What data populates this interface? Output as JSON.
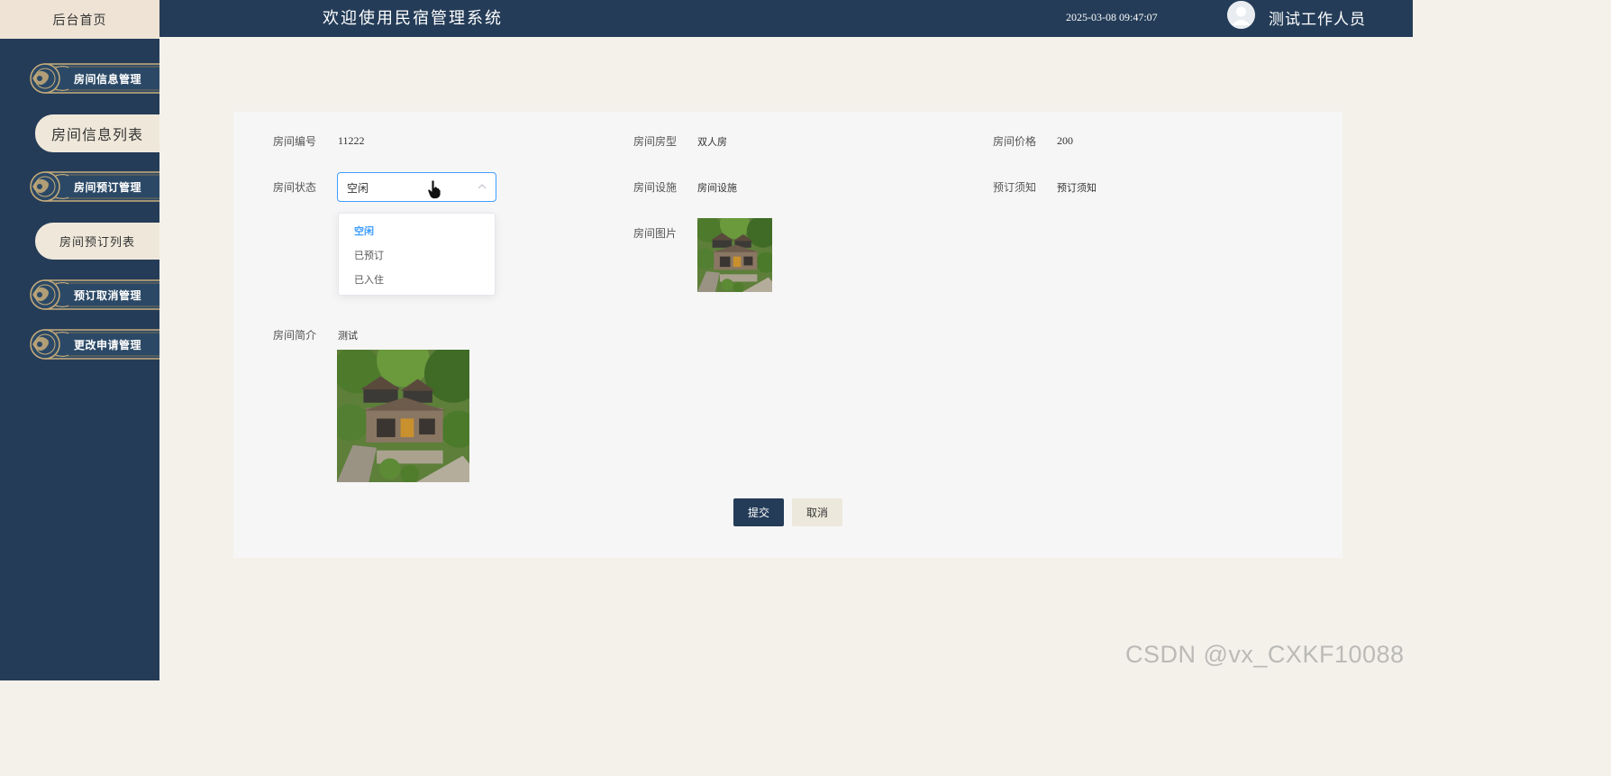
{
  "header": {
    "home_tab": "后台首页",
    "app_title": "欢迎使用民宿管理系统",
    "clock": "2025-03-08 09:47:07",
    "user_name": "测试工作人员"
  },
  "sidebar": {
    "items": [
      {
        "label": "房间信息管理",
        "type": "group"
      },
      {
        "label": "房间信息列表",
        "type": "submenu"
      },
      {
        "label": "房间预订管理",
        "type": "group"
      },
      {
        "label": "房间预订列表",
        "type": "submenu"
      },
      {
        "label": "预订取消管理",
        "type": "group"
      },
      {
        "label": "更改申请管理",
        "type": "group"
      }
    ]
  },
  "form": {
    "room_number": {
      "label": "房间编号",
      "value": "11222"
    },
    "room_type": {
      "label": "房间房型",
      "value": "双人房"
    },
    "room_price": {
      "label": "房间价格",
      "value": "200"
    },
    "room_status": {
      "label": "房间状态",
      "value": "空闲",
      "options": [
        "空闲",
        "已预订",
        "已入住"
      ]
    },
    "room_facilities": {
      "label": "房间设施",
      "value": "房间设施"
    },
    "booking_notice": {
      "label": "预订须知",
      "value": "预订须知"
    },
    "room_image": {
      "label": "房间图片"
    },
    "room_intro": {
      "label": "房间简介",
      "value": "测试"
    }
  },
  "actions": {
    "submit": "提交",
    "cancel": "取消"
  },
  "watermark": "CSDN @vx_CXKF10088",
  "colors": {
    "navy": "#243c58",
    "cream": "#efe8da",
    "page_bg": "#f3f1ea",
    "accent": "#409eff"
  }
}
